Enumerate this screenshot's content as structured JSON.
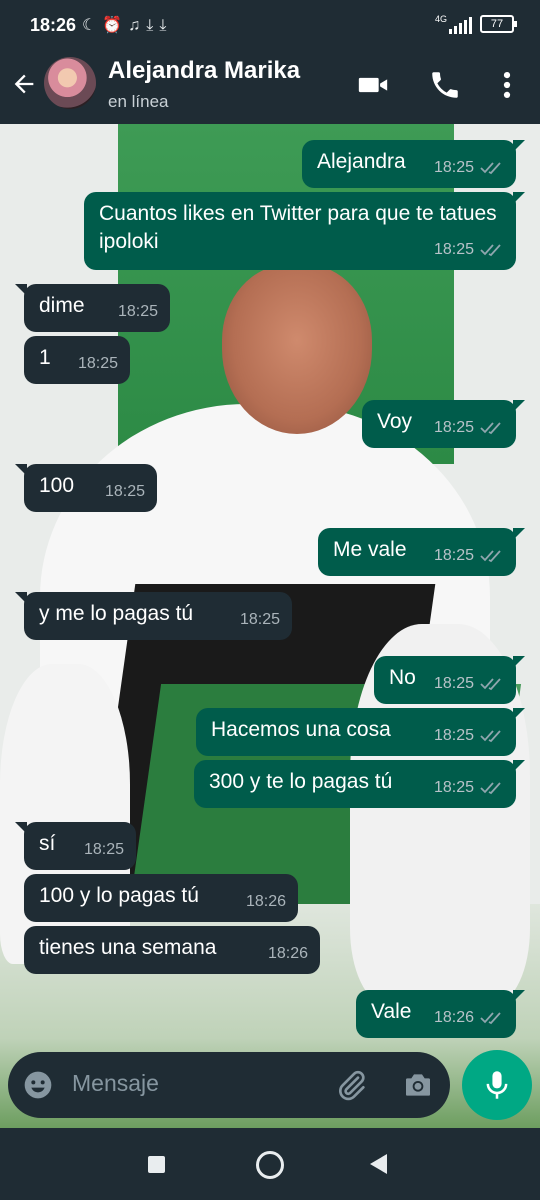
{
  "status_bar": {
    "time": "18:26",
    "icons": [
      "moon-icon",
      "alarm-icon",
      "headphones-icon",
      "download-icon",
      "download-icon"
    ],
    "network": "4G",
    "battery": "77"
  },
  "header": {
    "contact_name": "Alejandra Marika",
    "contact_status": "en línea",
    "icons": [
      "back-arrow-icon",
      "video-call-icon",
      "phone-icon",
      "more-options-icon"
    ]
  },
  "messages": [
    {
      "dir": "out",
      "text": "Alejandra",
      "time": "18:25"
    },
    {
      "dir": "out",
      "text": "Cuantos likes en Twitter para que te tatues ipoloki",
      "time": "18:25"
    },
    {
      "dir": "in",
      "text": "dime",
      "time": "18:25"
    },
    {
      "dir": "in",
      "text": "1",
      "time": "18:25"
    },
    {
      "dir": "out",
      "text": "Voy",
      "time": "18:25"
    },
    {
      "dir": "in",
      "text": "100",
      "time": "18:25"
    },
    {
      "dir": "out",
      "text": "Me vale",
      "time": "18:25"
    },
    {
      "dir": "in",
      "text": "y me lo pagas tú",
      "time": "18:25"
    },
    {
      "dir": "out",
      "text": "No",
      "time": "18:25"
    },
    {
      "dir": "out",
      "text": "Hacemos una cosa",
      "time": "18:25"
    },
    {
      "dir": "out",
      "text": "300 y te lo pagas tú",
      "time": "18:25"
    },
    {
      "dir": "in",
      "text": "sí",
      "time": "18:25"
    },
    {
      "dir": "in",
      "text": "100 y lo pagas tú",
      "time": "18:26"
    },
    {
      "dir": "in",
      "text": "tienes una semana",
      "time": "18:26"
    },
    {
      "dir": "out",
      "text": "Vale",
      "time": "18:26"
    }
  ],
  "composer": {
    "placeholder": "Mensaje"
  },
  "colors": {
    "outgoing_bubble": "#005c4b",
    "incoming_bubble": "#1f2c34",
    "accent": "#00a884",
    "bar": "#1f2c34"
  }
}
